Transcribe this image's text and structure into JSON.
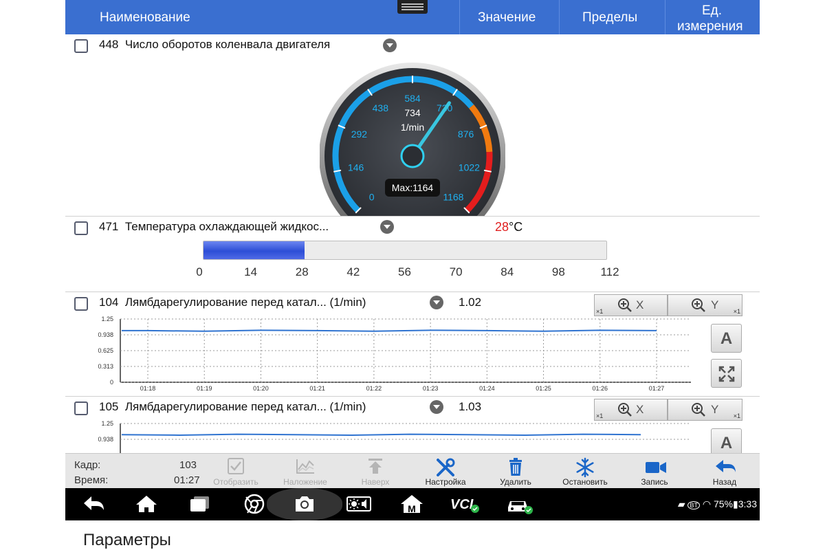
{
  "header": {
    "col_name": "Наименование",
    "col_value": "Значение",
    "col_limits": "Пределы",
    "col_unit_line1": "Ед.",
    "col_unit_line2": "измерения"
  },
  "rows": [
    {
      "id": "448",
      "name": "Число оборотов коленвала двигателя",
      "gauge": {
        "value": "734",
        "unit": "1/min",
        "max_label": "Max:1164",
        "needle_value": 734,
        "scale_max": 1168,
        "ticks": [
          "0",
          "146",
          "292",
          "438",
          "584",
          "730",
          "876",
          "1022",
          "1168"
        ]
      }
    },
    {
      "id": "471",
      "name": "Температура охлаждающей жидкос...",
      "value": "28",
      "unit": "°C",
      "bar_value": 28,
      "bar_max": 112,
      "ticks": [
        "0",
        "14",
        "28",
        "42",
        "56",
        "70",
        "84",
        "98",
        "112"
      ]
    },
    {
      "id": "104",
      "name": "Лямбдарегулирование перед катал... (1/min)",
      "value": "1.02",
      "chart_y_ticks": [
        "1.25",
        "0.938",
        "0.625",
        "0.313",
        "0"
      ],
      "chart_x_ticks": [
        "01:18",
        "01:19",
        "01:20",
        "01:21",
        "01:22",
        "01:23",
        "01:24",
        "01:25",
        "01:26",
        "01:27"
      ]
    },
    {
      "id": "105",
      "name": "Лямбдарегулирование перед катал... (1/min)",
      "value": "1.03",
      "chart_y_ticks": [
        "1.25",
        "0.938"
      ]
    }
  ],
  "chart_data": [
    {
      "type": "line",
      "ylim": [
        0,
        1.25
      ],
      "x": [
        "01:18",
        "01:19",
        "01:20",
        "01:21",
        "01:22",
        "01:23",
        "01:24",
        "01:25",
        "01:26",
        "01:27"
      ],
      "series": [
        {
          "values": [
            1.02,
            1.02,
            1.02,
            1.02,
            1.02,
            1.02,
            1.02,
            1.02,
            1.02,
            1.02
          ]
        }
      ]
    },
    {
      "type": "line",
      "ylim": [
        0,
        1.25
      ],
      "series": [
        {
          "values": [
            1.03,
            1.03,
            1.03,
            1.03,
            1.03,
            1.03,
            1.03,
            1.03,
            1.03,
            1.03
          ]
        }
      ]
    }
  ],
  "zoom": {
    "x_label": "X",
    "y_label": "Y",
    "factor": "×1",
    "auto_label": "A"
  },
  "status": {
    "frame_label": "Кадр:",
    "frame_value": "103",
    "time_label": "Время:",
    "time_value": "01:27"
  },
  "toolbar": [
    {
      "label": "Отобразить",
      "icon": "checkbox-icon",
      "enabled": false
    },
    {
      "label": "Наложение",
      "icon": "overlay-chart-icon",
      "enabled": false
    },
    {
      "label": "Наверх",
      "icon": "arrow-up-icon",
      "enabled": false
    },
    {
      "label": "Настройка",
      "icon": "tools-icon",
      "enabled": true
    },
    {
      "label": "Удалить",
      "icon": "trash-icon",
      "enabled": true
    },
    {
      "label": "Остановить",
      "icon": "snowflake-icon",
      "enabled": true
    },
    {
      "label": "Запись",
      "icon": "video-camera-icon",
      "enabled": true
    },
    {
      "label": "Назад",
      "icon": "back-arrow-icon",
      "enabled": true
    }
  ],
  "navbar": {
    "vci_label": "VCI",
    "m_label": "M",
    "battery": "75%",
    "clock": "3:33",
    "bt_label": "BT"
  },
  "caption": "Параметры",
  "colors": {
    "header": "#3a6fd0",
    "accent_blue": "#1ba0e8",
    "value_red": "#e02020",
    "line": "#2f73d0"
  }
}
